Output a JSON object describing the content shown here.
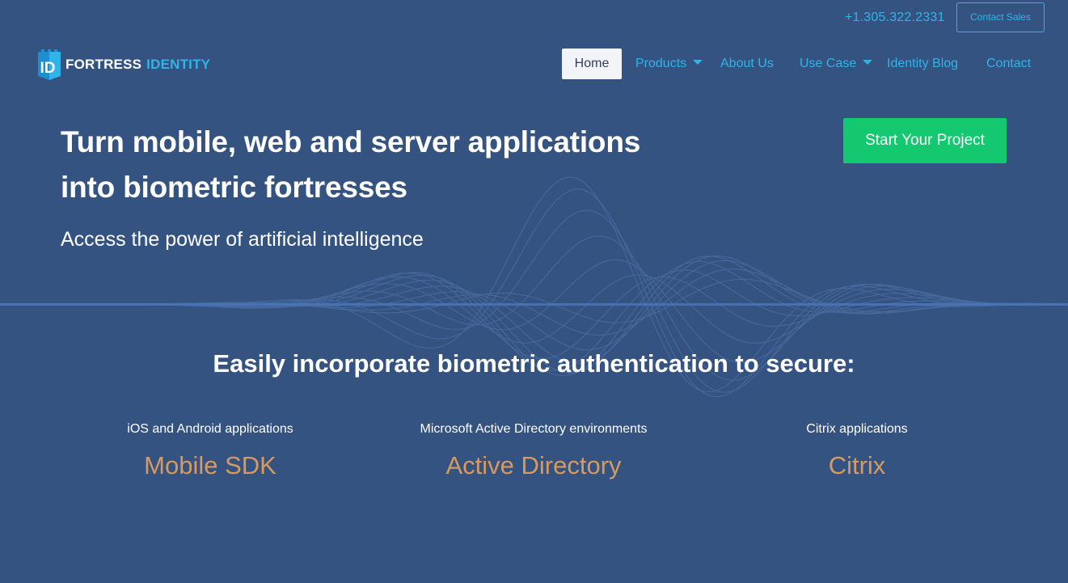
{
  "topbar": {
    "phone": "+1.305.322.2331",
    "contact_sales_label": "Contact Sales"
  },
  "logo": {
    "mark_letters": "ID",
    "word_primary": "FORTRESS",
    "word_accent": "IDENTITY"
  },
  "nav": {
    "items": [
      {
        "label": "Home",
        "active": true,
        "has_dropdown": false
      },
      {
        "label": "Products",
        "active": false,
        "has_dropdown": true
      },
      {
        "label": "About Us",
        "active": false,
        "has_dropdown": false
      },
      {
        "label": "Use Case",
        "active": false,
        "has_dropdown": true
      },
      {
        "label": "Identity Blog",
        "active": false,
        "has_dropdown": false
      },
      {
        "label": "Contact",
        "active": false,
        "has_dropdown": false
      }
    ]
  },
  "hero": {
    "title_line1": "Turn mobile, web and server applications",
    "title_line2": "into biometric fortresses",
    "subtitle": "Access the power of artificial intelligence",
    "cta_label": "Start Your Project"
  },
  "section": {
    "title": "Easily incorporate biometric authentication to secure:",
    "features": [
      {
        "caption": "iOS and Android applications",
        "name": "Mobile SDK"
      },
      {
        "caption": "Microsoft Active Directory environments",
        "name": "Active Directory"
      },
      {
        "caption": "Citrix applications",
        "name": "Citrix"
      }
    ]
  },
  "colors": {
    "background": "#355380",
    "accent_blue": "#2fb4ea",
    "cta_green": "#13c86f",
    "feature_orange": "#d49a62",
    "active_nav_bg": "#f2f4f8"
  },
  "icons": {
    "dropdown": "chevron-down-icon",
    "logo": "fortress-id-logo-icon"
  }
}
